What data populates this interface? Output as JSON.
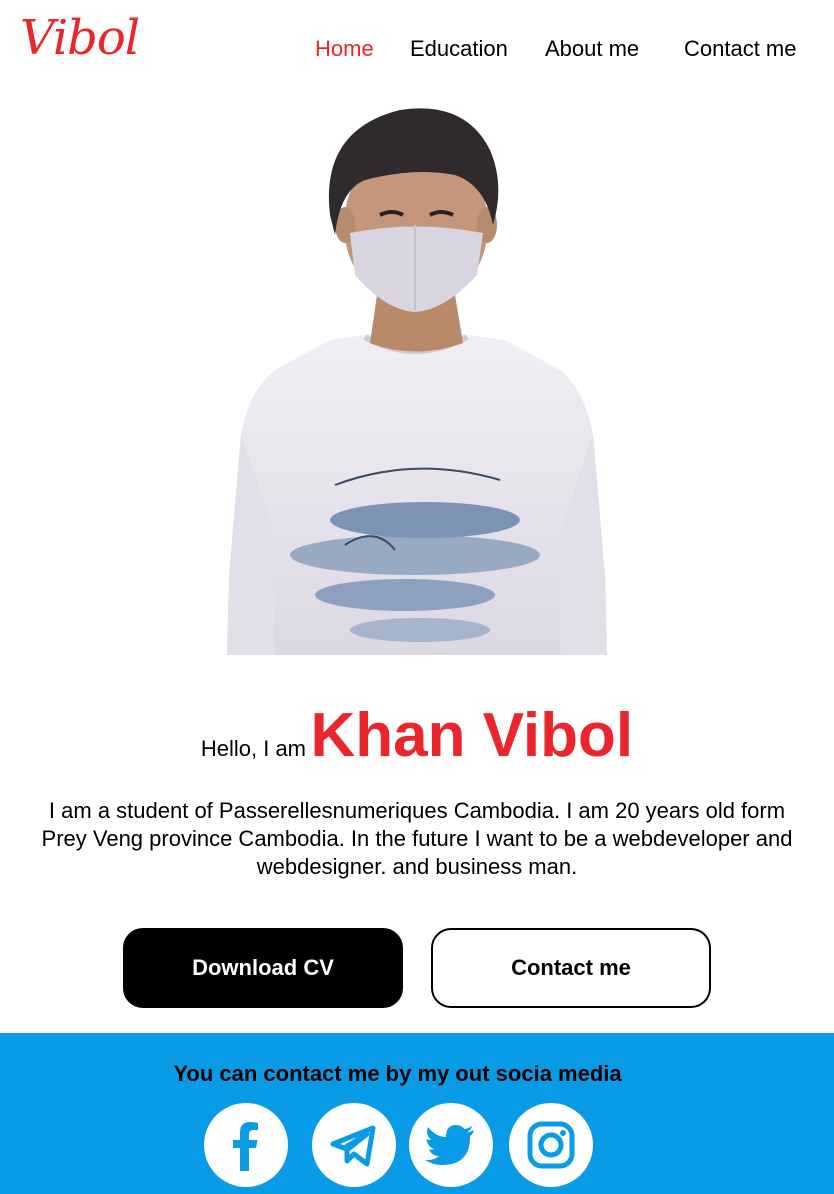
{
  "header": {
    "logo": "Vibol",
    "nav": [
      {
        "label": "Home",
        "active": true
      },
      {
        "label": "Education",
        "active": false
      },
      {
        "label": "About me",
        "active": false
      },
      {
        "label": "Contact me",
        "active": false
      }
    ]
  },
  "hero": {
    "greeting": "Hello, I am",
    "name": "Khan Vibol",
    "bio": "I am a student of Passerellesnumeriques Cambodia. I am 20 years old form Prey Veng province Cambodia. In the future I want to be a webdeveloper and webdesigner. and business man.",
    "buttons": {
      "download": "Download CV",
      "contact": "Contact me"
    }
  },
  "footer": {
    "title": "You can contact me by my out socia media",
    "social_icons": [
      "facebook-icon",
      "telegram-icon",
      "twitter-icon",
      "instagram-icon"
    ]
  },
  "colors": {
    "accent": "#e8262b",
    "footer_bg": "#0a9be6",
    "social_icon": "#0a9be6"
  }
}
